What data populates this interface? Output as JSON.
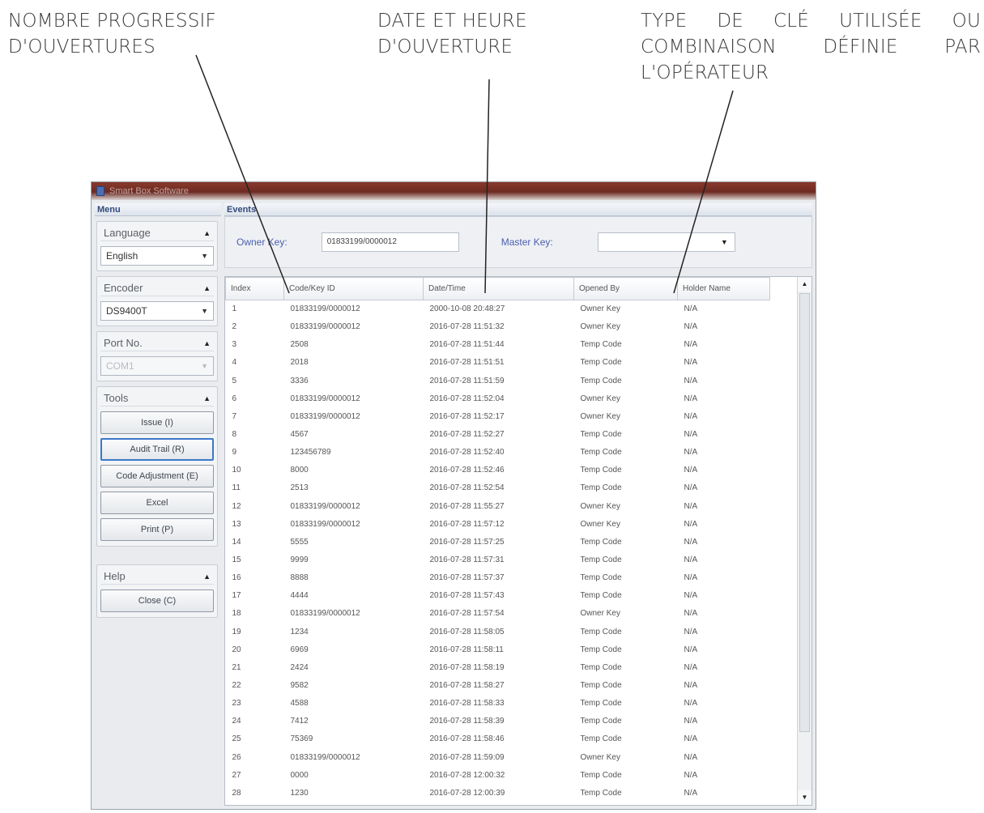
{
  "callouts": {
    "count": [
      "NOMBRE PROGRESSIF",
      "D'OUVERTURES"
    ],
    "date": [
      "DATE ET HEURE",
      "D'OUVERTURE"
    ],
    "type_line1": [
      "TYPE",
      "DE",
      "CLÉ",
      "UTILISÉE",
      "OU"
    ],
    "type_line2": [
      "COMBINAISON",
      "DÉFINIE",
      "PAR"
    ],
    "type_line3": "L'OPÉRATEUR"
  },
  "window": {
    "title": "Smart Box Software"
  },
  "menu": {
    "header": "Menu",
    "language": {
      "title": "Language",
      "value": "English"
    },
    "encoder": {
      "title": "Encoder",
      "value": "DS9400T"
    },
    "port": {
      "title": "Port No.",
      "value": "COM1"
    },
    "tools": {
      "title": "Tools",
      "buttons": [
        "Issue (I)",
        "Audit Trail (R)",
        "Code Adjustment (E)",
        "Excel",
        "Print (P)"
      ]
    },
    "help": {
      "title": "Help",
      "close": "Close (C)"
    }
  },
  "events": {
    "header": "Events",
    "owner_label": "Owner Key:",
    "owner_value": "01833199/0000012",
    "master_label": "Master Key:",
    "master_value": "",
    "columns": [
      "Index",
      "Code/Key ID",
      "Date/Time",
      "Opened By",
      "Holder Name"
    ],
    "rows": [
      [
        "1",
        "01833199/0000012",
        "2000-10-08 20:48:27",
        "Owner Key",
        "N/A"
      ],
      [
        "2",
        "01833199/0000012",
        "2016-07-28 11:51:32",
        "Owner Key",
        "N/A"
      ],
      [
        "3",
        "2508",
        "2016-07-28 11:51:44",
        "Temp Code",
        "N/A"
      ],
      [
        "4",
        "2018",
        "2016-07-28 11:51:51",
        "Temp Code",
        "N/A"
      ],
      [
        "5",
        "3336",
        "2016-07-28 11:51:59",
        "Temp Code",
        "N/A"
      ],
      [
        "6",
        "01833199/0000012",
        "2016-07-28 11:52:04",
        "Owner Key",
        "N/A"
      ],
      [
        "7",
        "01833199/0000012",
        "2016-07-28 11:52:17",
        "Owner Key",
        "N/A"
      ],
      [
        "8",
        "4567",
        "2016-07-28 11:52:27",
        "Temp Code",
        "N/A"
      ],
      [
        "9",
        "123456789",
        "2016-07-28 11:52:40",
        "Temp Code",
        "N/A"
      ],
      [
        "10",
        "8000",
        "2016-07-28 11:52:46",
        "Temp Code",
        "N/A"
      ],
      [
        "11",
        "2513",
        "2016-07-28 11:52:54",
        "Temp Code",
        "N/A"
      ],
      [
        "12",
        "01833199/0000012",
        "2016-07-28 11:55:27",
        "Owner Key",
        "N/A"
      ],
      [
        "13",
        "01833199/0000012",
        "2016-07-28 11:57:12",
        "Owner Key",
        "N/A"
      ],
      [
        "14",
        "5555",
        "2016-07-28 11:57:25",
        "Temp Code",
        "N/A"
      ],
      [
        "15",
        "9999",
        "2016-07-28 11:57:31",
        "Temp Code",
        "N/A"
      ],
      [
        "16",
        "8888",
        "2016-07-28 11:57:37",
        "Temp Code",
        "N/A"
      ],
      [
        "17",
        "4444",
        "2016-07-28 11:57:43",
        "Temp Code",
        "N/A"
      ],
      [
        "18",
        "01833199/0000012",
        "2016-07-28 11:57:54",
        "Owner Key",
        "N/A"
      ],
      [
        "19",
        "1234",
        "2016-07-28 11:58:05",
        "Temp Code",
        "N/A"
      ],
      [
        "20",
        "6969",
        "2016-07-28 11:58:11",
        "Temp Code",
        "N/A"
      ],
      [
        "21",
        "2424",
        "2016-07-28 11:58:19",
        "Temp Code",
        "N/A"
      ],
      [
        "22",
        "9582",
        "2016-07-28 11:58:27",
        "Temp Code",
        "N/A"
      ],
      [
        "23",
        "4588",
        "2016-07-28 11:58:33",
        "Temp Code",
        "N/A"
      ],
      [
        "24",
        "7412",
        "2016-07-28 11:58:39",
        "Temp Code",
        "N/A"
      ],
      [
        "25",
        "75369",
        "2016-07-28 11:58:46",
        "Temp Code",
        "N/A"
      ],
      [
        "26",
        "01833199/0000012",
        "2016-07-28 11:59:09",
        "Owner Key",
        "N/A"
      ],
      [
        "27",
        "0000",
        "2016-07-28 12:00:32",
        "Temp Code",
        "N/A"
      ],
      [
        "28",
        "1230",
        "2016-07-28 12:00:39",
        "Temp Code",
        "N/A"
      ]
    ]
  }
}
